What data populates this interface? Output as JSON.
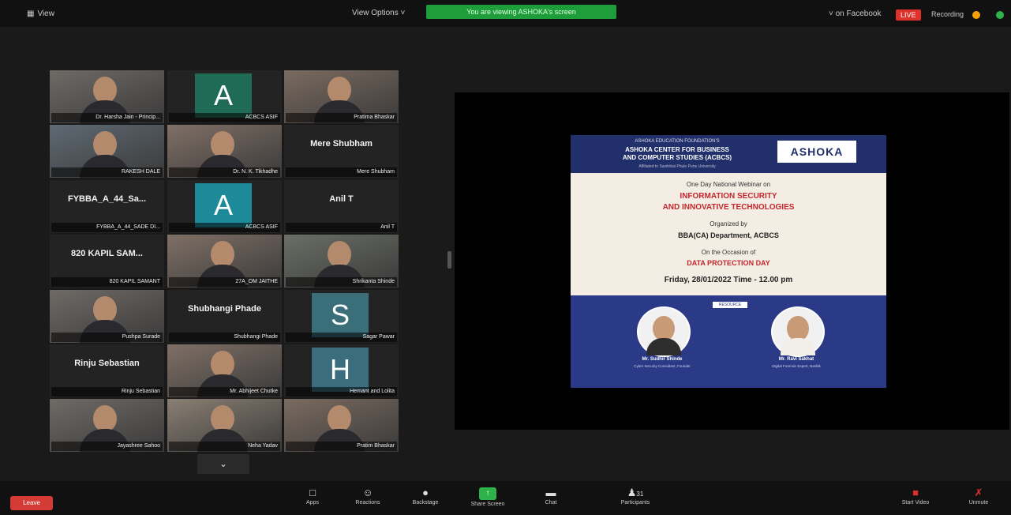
{
  "topbar": {
    "view_label": "View",
    "view_options": "View Options ˅",
    "viewing_banner": "You are viewing ASHOKA's screen",
    "live_on": "˅ on Facebook",
    "live_badge": "LIVE",
    "recording": "Recording"
  },
  "participants": [
    {
      "name": "Dr. Harsha Jain - Princip...",
      "kind": "video"
    },
    {
      "name": "ACBCS ASIF",
      "kind": "initial",
      "initial": "A",
      "color": "#1f6b55"
    },
    {
      "name": "Pratima Bhaskar",
      "kind": "video"
    },
    {
      "name": "RAKESH DALE",
      "kind": "video",
      "active": true
    },
    {
      "name": "Dr. N. K. Tikhadhe",
      "kind": "video"
    },
    {
      "name": "Mere Shubham",
      "kind": "text",
      "display": "Mere Shubham"
    },
    {
      "name": "FYBBA_A_44_SADE DI...",
      "kind": "text",
      "display": "FYBBA_A_44_Sa..."
    },
    {
      "name": "ACBCS ASIF",
      "kind": "initial",
      "initial": "A",
      "color": "#1d8a9a"
    },
    {
      "name": "Anil T",
      "kind": "text",
      "display": "Anil T"
    },
    {
      "name": "820 KAPIL SAMANT",
      "kind": "text",
      "display": "820 KAPIL SAM..."
    },
    {
      "name": "27A_OM JAITHE",
      "kind": "video"
    },
    {
      "name": "Shrikanta Shinde",
      "kind": "video"
    },
    {
      "name": "Pushpa Surade",
      "kind": "video"
    },
    {
      "name": "Shubhangi Phade",
      "kind": "text",
      "display": "Shubhangi Phade"
    },
    {
      "name": "Sagar Pawar",
      "kind": "initial",
      "initial": "S",
      "color": "#3a6f7a"
    },
    {
      "name": "Rinju Sebastian",
      "kind": "text",
      "display": "Rinju Sebastian"
    },
    {
      "name": "Mr. Abhijeet Chutke",
      "kind": "video"
    },
    {
      "name": "Hemant and Lolita",
      "kind": "initial",
      "initial": "H",
      "color": "#3b6d7e"
    },
    {
      "name": "Jayashree Sahoo",
      "kind": "video"
    },
    {
      "name": "Neha Yadav",
      "kind": "video"
    },
    {
      "name": "Pratim Bhaskar",
      "kind": "video"
    }
  ],
  "slide": {
    "org_line": "ASHOKA EDUCATION FOUNDATION'S",
    "center_line1": "ASHOKA CENTER FOR BUSINESS",
    "center_line2": "AND COMPUTER STUDIES (ACBCS)",
    "affiliation": "Affiliated to Savitribai Phule Pune University",
    "logo_text": "ASHOKA",
    "webinar_intro": "One Day National Webinar on",
    "topic_line1": "INFORMATION SECURITY",
    "topic_line2": "AND INNOVATIVE TECHNOLOGIES",
    "organized_by": "Organized by",
    "department": "BBA(CA) Department, ACBCS",
    "occasion": "On the Occasion of",
    "occasion_day": "DATA PROTECTION DAY",
    "date_time": "Friday, 28/01/2022   Time - 12.00 pm",
    "speakers_tag": "RESOURCE PERSONS",
    "speaker1_name": "Mr. Sudhir Shinde",
    "speaker1_role": "Cyber Security Consultant, Founder",
    "speaker2_name": "Mr. Ravi Sakhat",
    "speaker2_role": "Digital Forensic Expert, Nashik"
  },
  "bottombar": {
    "leave": "Leave",
    "apps": "Apps",
    "reactions": "Reactions",
    "backstage": "Backstage",
    "share_screen": "Share Screen",
    "chat": "Chat",
    "participants": "Participants",
    "participants_count": "31",
    "start_video": "Start Video",
    "unmute": "Unmute"
  }
}
